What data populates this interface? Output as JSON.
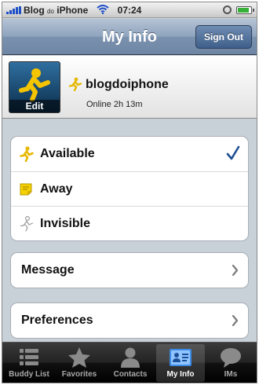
{
  "status_bar": {
    "carrier": "Blog",
    "carrier_small": "do",
    "carrier_suffix": "iPhone",
    "time": "07:24",
    "battery_level": 0.85
  },
  "nav": {
    "title": "My Info",
    "sign_out_label": "Sign Out"
  },
  "profile": {
    "avatar_edit_label": "Edit",
    "username": "blogdoiphone",
    "online_status": "Online 2h 13m"
  },
  "presence": {
    "selected": "available",
    "items": [
      {
        "id": "available",
        "label": "Available"
      },
      {
        "id": "away",
        "label": "Away"
      },
      {
        "id": "invisible",
        "label": "Invisible"
      }
    ]
  },
  "menu": {
    "message_label": "Message",
    "preferences_label": "Preferences"
  },
  "tabs": [
    {
      "id": "buddy-list",
      "label": "Buddy List",
      "icon": "list-icon"
    },
    {
      "id": "favorites",
      "label": "Favorites",
      "icon": "star-icon"
    },
    {
      "id": "contacts",
      "label": "Contacts",
      "icon": "person-icon"
    },
    {
      "id": "my-info",
      "label": "My Info",
      "icon": "id-card-icon"
    },
    {
      "id": "ims",
      "label": "IMs",
      "icon": "speech-bubble-icon"
    }
  ],
  "active_tab": "my-info",
  "colors": {
    "accent_blue": "#1d4f91",
    "aim_yellow": "#f5c400",
    "nav_bar": "#7b92af"
  }
}
